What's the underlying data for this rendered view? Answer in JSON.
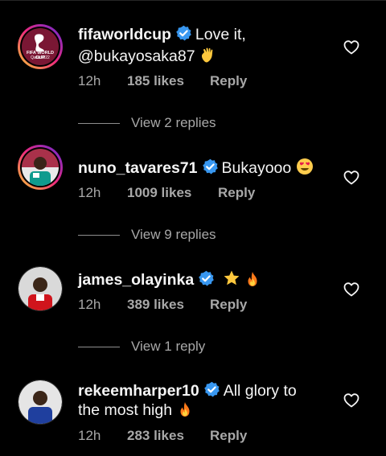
{
  "comments": [
    {
      "username": "fifaworldcup",
      "message_line1": "Love it,",
      "message_line2": "@bukayosaka87",
      "emoji": "wave-emoji",
      "time": "12h",
      "likes": "185 likes",
      "reply": "Reply",
      "view_replies": "View 2 replies",
      "avatar_text_top": "FIFA WORLD CUP",
      "avatar_text_bottom": "Qatar2022"
    },
    {
      "username": "nuno_tavares71",
      "message": "Bukayooo",
      "emoji": "heart-eyes-emoji",
      "time": "12h",
      "likes": "1009 likes",
      "reply": "Reply",
      "view_replies": "View 9 replies"
    },
    {
      "username": "james_olayinka",
      "message": "",
      "emoji": "star-fire-emoji",
      "time": "12h",
      "likes": "389 likes",
      "reply": "Reply",
      "view_replies": "View 1 reply"
    },
    {
      "username": "rekeemharper10",
      "message_line1": "All glory to",
      "message_line2": "the most high",
      "emoji": "fire-emoji",
      "time": "12h",
      "likes": "283 likes",
      "reply": "Reply"
    }
  ],
  "colors": {
    "background": "#000000",
    "text": "#f5f5f5",
    "muted": "#a8a8a8",
    "verified": "#3897f0",
    "fifa_maroon": "#7a1734"
  }
}
